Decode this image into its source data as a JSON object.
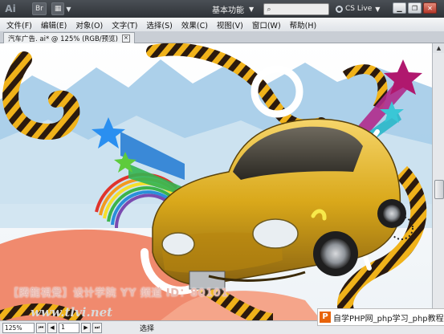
{
  "titlebar": {
    "app_logo": "Ai",
    "bridge_label": "Br",
    "arrange_label": "▦",
    "workspace_label": "基本功能",
    "search_placeholder": "",
    "cslive_label": "CS Live",
    "icons": [
      "app-logo-icon",
      "bridge-icon",
      "arrange-documents-icon",
      "search-icon",
      "minimize-icon",
      "restore-icon",
      "close-icon"
    ]
  },
  "menubar": {
    "items": [
      "文件(F)",
      "编辑(E)",
      "对象(O)",
      "文字(T)",
      "选择(S)",
      "效果(C)",
      "视图(V)",
      "窗口(W)",
      "帮助(H)"
    ]
  },
  "tab": {
    "label": "汽车广告. ai* @ 125% (RGB/预览)",
    "close": "×"
  },
  "artwork": {
    "watermark_text": "【腾龍視覺】设计学院  YY 频道 ID：80101",
    "watermark_url": "www.tlvi.net"
  },
  "statusbar": {
    "zoom_value": "125%",
    "page_value": "1",
    "status_text": "选择"
  },
  "overlay_badge": {
    "icon_letter": "P",
    "text": "自学PHP网_php学习_php教程"
  },
  "colors": {
    "titlebar": "#3a3f45",
    "menubar": "#e9ecef",
    "car_body": "#e0b21c",
    "stripe_dark": "#2b1a0e",
    "stripe_gold": "#f0b21a",
    "salmon": "#f08a6e",
    "sky_blue": "#9ec8e6",
    "badge_orange": "#e8630a"
  }
}
